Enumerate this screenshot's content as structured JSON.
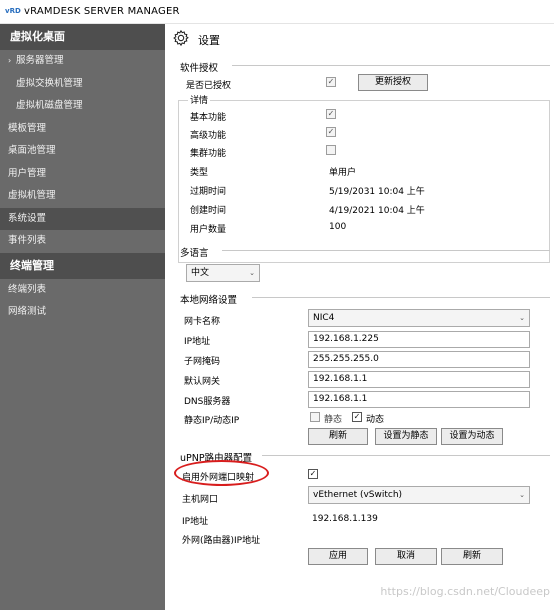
{
  "window": {
    "icon_text": "vRD",
    "title": "vRAMDESK SERVER MANAGER"
  },
  "sidebar": {
    "section1": "虚拟化桌面",
    "items": [
      {
        "label": "服务器管理",
        "caret": "›"
      },
      {
        "label": "虚拟交换机管理"
      },
      {
        "label": "虚拟机磁盘管理"
      },
      {
        "label": "模板管理"
      },
      {
        "label": "桌面池管理"
      },
      {
        "label": "用户管理"
      },
      {
        "label": "虚拟机管理"
      },
      {
        "label": "系统设置"
      },
      {
        "label": "事件列表"
      }
    ],
    "section2": "终端管理",
    "items2": [
      {
        "label": "终端列表"
      },
      {
        "label": "网络测试"
      }
    ]
  },
  "main": {
    "title": "设置",
    "license": {
      "section_title": "软件授权",
      "authorized_label": "是否已授权",
      "authorized_check": "✓",
      "update_button": "更新授权",
      "details_title": "详情",
      "rows": [
        {
          "label": "基本功能",
          "check": "✓"
        },
        {
          "label": "高级功能",
          "check": "✓"
        },
        {
          "label": "集群功能",
          "check": ""
        },
        {
          "label": "类型",
          "value": "单用户"
        },
        {
          "label": "过期时间",
          "value": "5/19/2031 10:04 上午"
        },
        {
          "label": "创建时间",
          "value": "4/19/2021 10:04 上午"
        },
        {
          "label": "用户数量",
          "value": "100"
        }
      ]
    },
    "language": {
      "section_title": "多语言",
      "selected": "中文"
    },
    "network": {
      "section_title": "本地网络设置",
      "nic_label": "网卡名称",
      "nic_value": "NIC4",
      "ip_label": "IP地址",
      "ip_value": "192.168.1.225",
      "mask_label": "子网掩码",
      "mask_value": "255.255.255.0",
      "gateway_label": "默认网关",
      "gateway_value": "192.168.1.1",
      "dns_label": "DNS服务器",
      "dns_value": "192.168.1.1",
      "mode_label": "静态IP/动态IP",
      "static_label": "静态",
      "dynamic_label": "动态",
      "dynamic_check": "✓",
      "refresh_button": "刷新",
      "set_static_button": "设置为静态",
      "set_dynamic_button": "设置为动态"
    },
    "upnp": {
      "section_title": "uPNP路由器配置",
      "enable_label": "启用外网端口映射",
      "enable_check": "✓",
      "host_nic_label": "主机网口",
      "host_nic_value": "vEthernet (vSwitch)",
      "ip_label": "IP地址",
      "ip_value": "192.168.1.139",
      "external_ip_label": "外网(路由器)IP地址",
      "apply_button": "应用",
      "cancel_button": "取消",
      "refresh_button": "刷新"
    }
  },
  "watermark": "https://blog.csdn.net/Cloudeep",
  "colors": {
    "sidebar_bg": "#6a6a6a",
    "sidebar_active": "#505050",
    "highlight_oval": "#d81d1d"
  }
}
